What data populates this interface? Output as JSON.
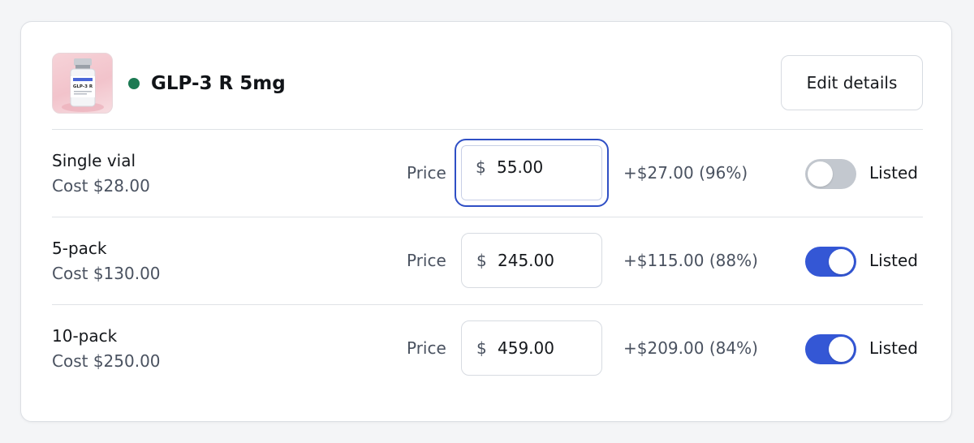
{
  "product": {
    "title": "GLP-3 R 5mg",
    "status_color": "#1c7a53",
    "thumbnail_icon": "product-vial-image",
    "thumbnail_label": "GLP-3 R",
    "edit_label": "Edit details"
  },
  "accent_color": "#3457d5",
  "variants": [
    {
      "name": "Single vial",
      "cost": "Cost $28.00",
      "price_label": "Price",
      "currency": "$",
      "price": "55.00",
      "margin": "+$27.00 (96%)",
      "listed": false,
      "listed_label": "Listed",
      "focused": true
    },
    {
      "name": "5-pack",
      "cost": "Cost $130.00",
      "price_label": "Price",
      "currency": "$",
      "price": "245.00",
      "margin": "+$115.00 (88%)",
      "listed": true,
      "listed_label": "Listed",
      "focused": false
    },
    {
      "name": "10-pack",
      "cost": "Cost $250.00",
      "price_label": "Price",
      "currency": "$",
      "price": "459.00",
      "margin": "+$209.00 (84%)",
      "listed": true,
      "listed_label": "Listed",
      "focused": false
    }
  ]
}
